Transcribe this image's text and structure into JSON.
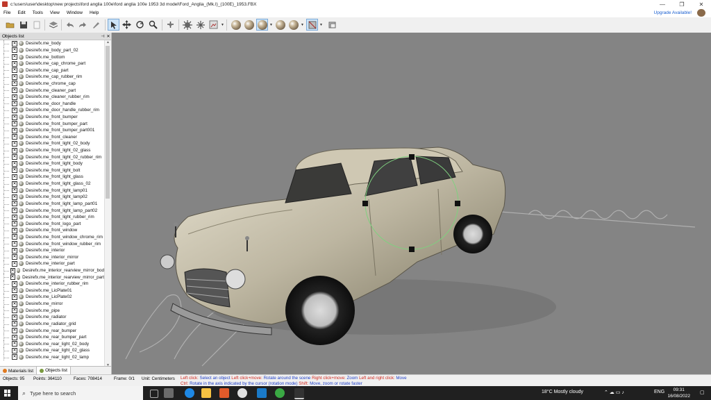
{
  "window": {
    "title": "c:\\users\\user\\desktop\\new projects\\ford anglia 100e\\ford anglia 100e 1953 3d model\\Ford_Anglia_(Mk.I)_(100E)_1953.FBX"
  },
  "menu": [
    "File",
    "Edit",
    "Tools",
    "View",
    "Window",
    "Help"
  ],
  "upgrade_label": "Upgrade Available!",
  "objects_panel": {
    "title": "Objects list",
    "items": [
      "Desirefx.me_body",
      "Desirefx.me_body_part_02",
      "Desirefx.me_bottom",
      "Desirefx.me_cap_chrome_part",
      "Desirefx.me_cap_part",
      "Desirefx.me_cap_rubber_rim",
      "Desirefx.me_chrome_cap",
      "Desirefx.me_cleaner_part",
      "Desirefx.me_cleaner_rubber_rim",
      "Desirefx.me_door_handle",
      "Desirefx.me_door_handle_rubber_rim",
      "Desirefx.me_front_bumper",
      "Desirefx.me_front_bumper_part",
      "Desirefx.me_front_bumper_part001",
      "Desirefx.me_front_cleaner",
      "Desirefx.me_front_light_02_body",
      "Desirefx.me_front_light_02_glass",
      "Desirefx.me_front_light_02_rubber_rim",
      "Desirefx.me_front_light_body",
      "Desirefx.me_front_light_bolt",
      "Desirefx.me_front_light_glass",
      "Desirefx.me_front_light_glass_02",
      "Desirefx.me_front_light_lamp01",
      "Desirefx.me_front_light_lamp02",
      "Desirefx.me_front_light_lamp_part01",
      "Desirefx.me_front_light_lamp_part02",
      "Desirefx.me_front_light_rubber_rim",
      "Desirefx.me_front_logo_part",
      "Desirefx.me_front_window",
      "Desirefx.me_front_window_chrome_rim",
      "Desirefx.me_front_window_rubber_rim",
      "Desirefx.me_interior",
      "Desirefx.me_interior_mirror",
      "Desirefx.me_interior_part",
      "Desirefx.me_interior_rearview_mirror_bod",
      "Desirefx.me_interior_rearview_mirror_part",
      "Desirefx.me_interior_rubber_rim",
      "Desirefx.me_LicPlate01",
      "Desirefx.me_LicPlate02",
      "Desirefx.me_mirror",
      "Desirefx.me_pipe",
      "Desirefx.me_radiator",
      "Desirefx.me_radiator_grid",
      "Desirefx.me_rear_bumper",
      "Desirefx.me_rear_bumper_part",
      "Desirefx.me_rear_light_02_body",
      "Desirefx.me_rear_light_02_glass",
      "Desirefx.me_rear_light_02_lamp"
    ]
  },
  "panel_tabs": [
    "Materials list",
    "Objects list"
  ],
  "status": {
    "objects": "Objects: 95",
    "points": "Points: 364110",
    "faces": "Faces: 708414",
    "frame": "Frame: 0/1",
    "unit": "Unit: Centimeters",
    "hint1": [
      {
        "k": "Left click:",
        "v": "Select an object"
      },
      {
        "k": "Left click+move:",
        "v": "Rotate around the scene"
      },
      {
        "k": "Right click+move:",
        "v": "Zoom"
      },
      {
        "k": "Left and right click:",
        "v": "Move"
      }
    ],
    "hint2": [
      {
        "k": "Ctrl:",
        "v": "Rotate in the axis indicated by the cursor (rotation mode)"
      },
      {
        "k": "Shift:",
        "v": "Move, zoom or rotate faster"
      }
    ]
  },
  "taskbar": {
    "search_placeholder": "Type here to search",
    "weather": "18°C  Mostly cloudy",
    "lang": "ENG",
    "time": "09:31",
    "date": "16/08/2022"
  },
  "colors": {
    "accent": "#1a5fd0",
    "status_key": "#d0261c",
    "status_value": "#2040c8",
    "viewport_bg": "#848484",
    "gizmo": "#7fd07f"
  }
}
